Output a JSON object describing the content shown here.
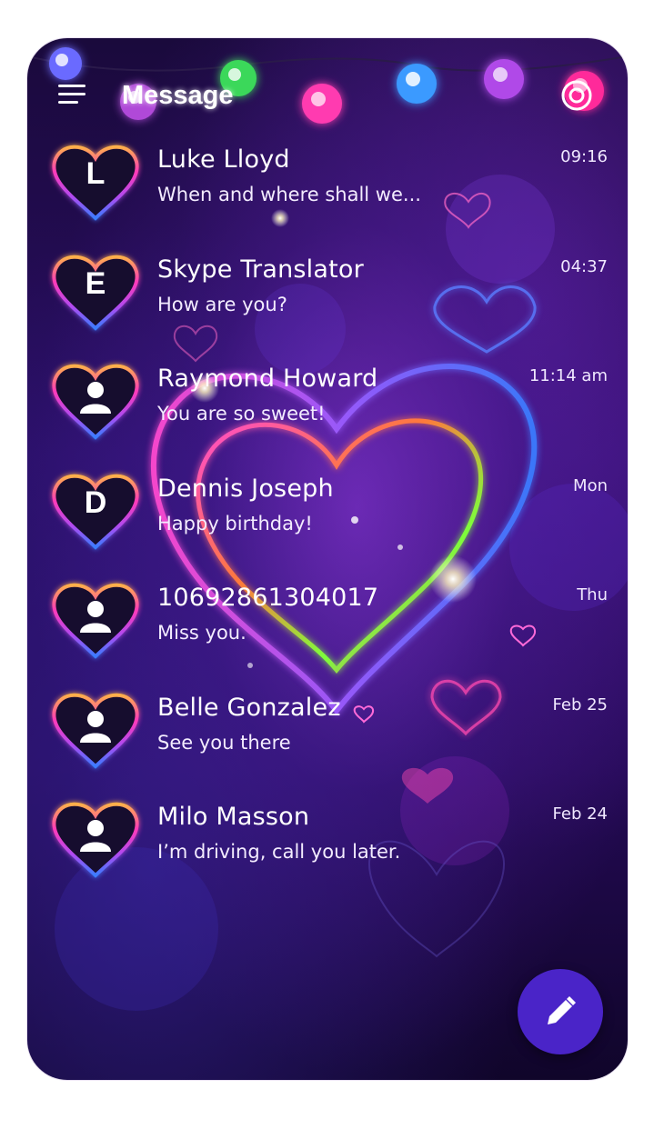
{
  "header": {
    "title": "Message",
    "menu_icon": "hamburger-menu-icon",
    "settings_icon": "settings-icon"
  },
  "colors": {
    "background_top": "#1a0a3c",
    "background_mid": "#2a0d63",
    "fab": "#4a24c8",
    "text": "#ffffff"
  },
  "conversations": [
    {
      "name": "Luke Lloyd",
      "avatar": "L",
      "avatar_type": "letter",
      "snippet": "When and where shall we...",
      "time": "09:16"
    },
    {
      "name": "Skype Translator",
      "avatar": "E",
      "avatar_type": "letter",
      "snippet": "How are you?",
      "time": "04:37"
    },
    {
      "name": "Raymond Howard",
      "avatar": "",
      "avatar_type": "person-icon",
      "snippet": "You are so sweet!",
      "time": "11:14 am"
    },
    {
      "name": "Dennis Joseph",
      "avatar": "D",
      "avatar_type": "letter",
      "snippet": "Happy birthday!",
      "time": "Mon"
    },
    {
      "name": "10692861304017",
      "avatar": "",
      "avatar_type": "person-icon",
      "snippet": "Miss you.",
      "time": "Thu"
    },
    {
      "name": "Belle Gonzalez",
      "avatar": "",
      "avatar_type": "person-icon",
      "snippet": "See you there",
      "time": "Feb 25"
    },
    {
      "name": "Milo Masson",
      "avatar": "",
      "avatar_type": "person-icon",
      "snippet": "I’m driving, call you later.",
      "time": "Feb 24"
    }
  ],
  "fab": {
    "icon": "pencil-icon"
  }
}
